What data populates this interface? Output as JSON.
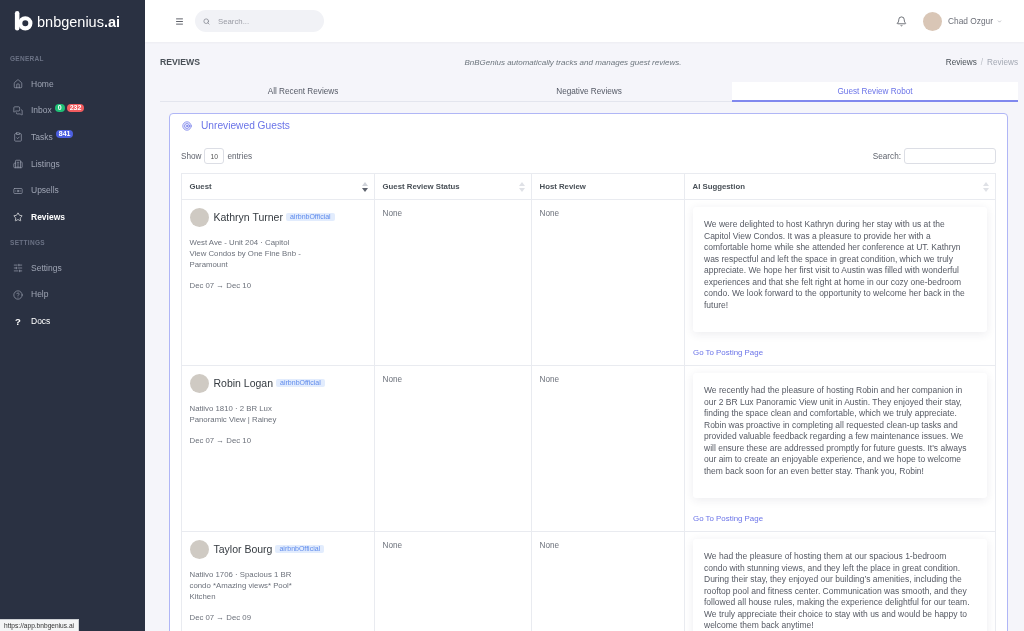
{
  "sidebar": {
    "logo": "bnbgenius**.ai**",
    "sections": [
      {
        "heading": "GENERAL",
        "items": [
          {
            "label": "Home",
            "kind": "page",
            "selected": false
          },
          {
            "label": "Inbox",
            "kind": "page",
            "selected": false,
            "badges": [
              {
                "text": "0",
                "color": "#1fbf75"
              },
              {
                "text": "232",
                "color": "#f25c5f"
              }
            ]
          },
          {
            "label": "Tasks",
            "kind": "page",
            "selected": false,
            "badges": [
              {
                "text": "841",
                "color": "#4c5fe0"
              }
            ]
          },
          {
            "label": "Listings",
            "kind": "page",
            "selected": false
          },
          {
            "label": "Upsells",
            "kind": "page",
            "selected": false
          },
          {
            "label": "Reviews",
            "kind": "page",
            "selected": true
          }
        ]
      },
      {
        "heading": "SETTINGS",
        "items": [
          {
            "label": "Settings",
            "kind": "page",
            "selected": false
          },
          {
            "label": "Help",
            "kind": "page",
            "selected": false
          },
          {
            "label": "Docs",
            "kind": "link",
            "selected": false,
            "glyph": "?"
          }
        ]
      }
    ]
  },
  "topbar": {
    "search": {
      "placeholder": "Search..."
    },
    "user": {
      "name": "Chad Ozgur"
    }
  },
  "page_header": {
    "title": "REVIEWS",
    "subtitle": "BnBGenius automatically tracks and manages guest reviews.",
    "breadcrumb": {
      "separator": "/",
      "items": [
        {
          "label": "Reviews",
          "current": false
        },
        {
          "label": "Reviews",
          "current": true
        }
      ]
    }
  },
  "tabs": [
    {
      "label": "All Recent Reviews",
      "selected": false
    },
    {
      "label": "Negative Reviews",
      "selected": false
    },
    {
      "label": "Guest Review Robot",
      "selected": true
    }
  ],
  "card": {
    "title": "Unreviewed Guests",
    "length_control": {
      "prefix": "Show",
      "value": "10",
      "suffix": "entries"
    },
    "search": {
      "label": "Search:"
    },
    "table": {
      "columns": [
        {
          "label": "Guest",
          "sortable": true,
          "sorted": true
        },
        {
          "label": "Guest Review Status",
          "sortable": true,
          "sorted": false
        },
        {
          "label": "Host Review",
          "sortable": false,
          "sorted": false
        },
        {
          "label": "AI Suggestion",
          "sortable": true,
          "sorted": false
        }
      ],
      "rows": [
        {
          "guest": {
            "name": "Kathryn Turner",
            "channel": "airbnbOfficial",
            "listing": "West Ave - Unit 204 · Capitol View Condos by One Fine Bnb - Paramount",
            "dates": "Dec 07 → Dec 10"
          },
          "guest_review_status": "None",
          "host_review": "None",
          "ai_suggestion": {
            "text": "We were delighted to host Kathryn during her stay with us at the Capitol View Condos. It was a pleasure to provide her with a comfortable home while she attended her conference at UT. Kathryn was respectful and left the space in great condition, which we truly appreciate. We hope her first visit to Austin was filled with wonderful experiences and that she felt right at home in our cozy one-bedroom condo. We look forward to the opportunity to welcome her back in the future!",
            "link": "Go To Posting Page"
          }
        },
        {
          "guest": {
            "name": "Robin Logan",
            "channel": "airbnbOfficial",
            "listing": "Natiivo 1810 · 2 BR Lux Panoramic View | Rainey",
            "dates": "Dec 07 → Dec 10"
          },
          "guest_review_status": "None",
          "host_review": "None",
          "ai_suggestion": {
            "text": "We recently had the pleasure of hosting Robin and her companion in our 2 BR Lux Panoramic View unit in Austin. They enjoyed their stay, finding the space clean and comfortable, which we truly appreciate. Robin was proactive in completing all requested clean-up tasks and provided valuable feedback regarding a few maintenance issues. We will ensure these are addressed promptly for future guests. It's always our aim to create an enjoyable experience, and we hope to welcome them back soon for an even better stay. Thank you, Robin!",
            "link": "Go To Posting Page"
          }
        },
        {
          "guest": {
            "name": "Taylor Bourg",
            "channel": "airbnbOfficial",
            "listing": "Natiivo 1706 · Spacious 1 BR condo *Amazing views* Pool* Kitchen",
            "dates": "Dec 07 → Dec 09"
          },
          "guest_review_status": "None",
          "host_review": "None",
          "ai_suggestion": {
            "text": "We had the pleasure of hosting them at our spacious 1-bedroom condo with stunning views, and they left the place in great condition. During their stay, they enjoyed our building’s amenities, including the rooftop pool and fitness center. Communication was smooth, and they followed all house rules, making the experience delightful for our team. We truly appreciate their choice to stay with us and would be happy to welcome them back anytime!"
          }
        }
      ]
    }
  },
  "status_url": "https://app.bnbgenius.ai"
}
